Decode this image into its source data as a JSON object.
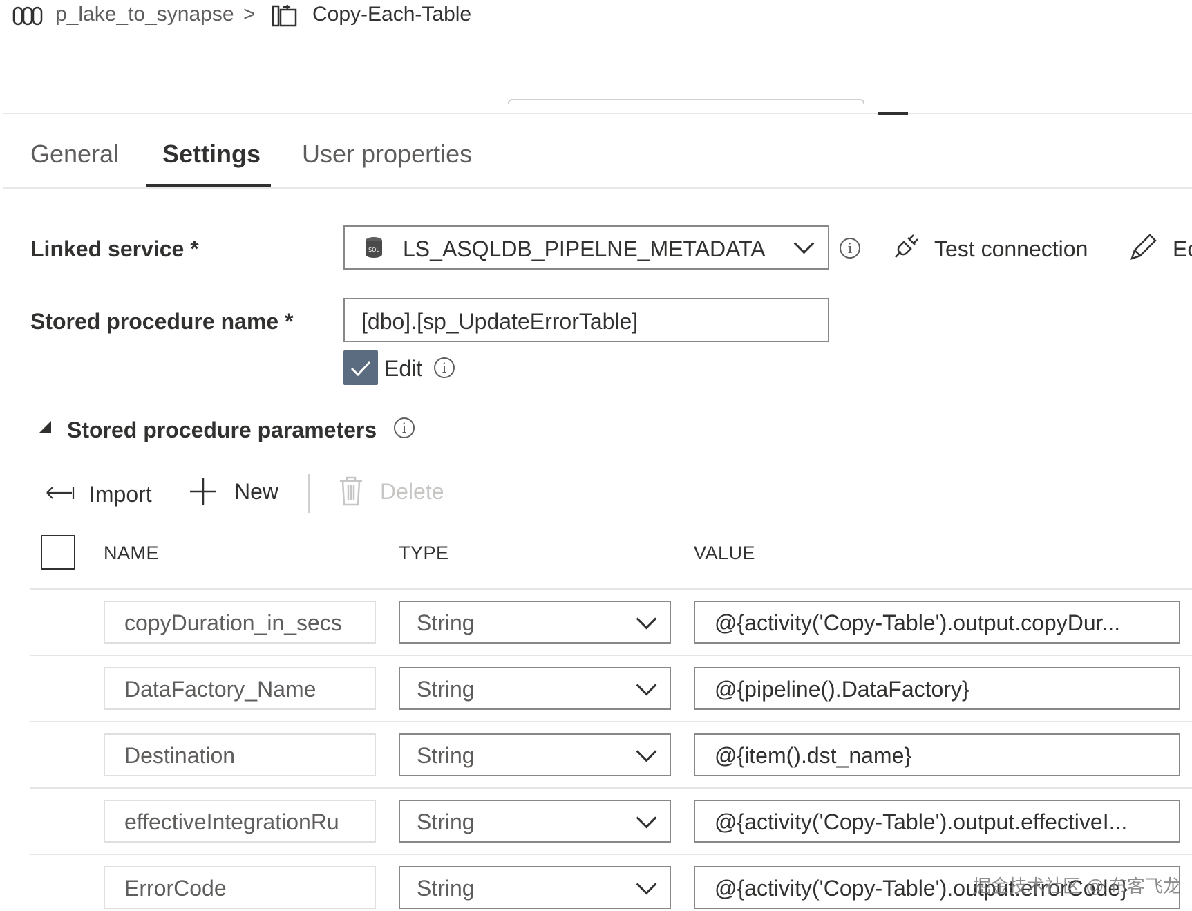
{
  "breadcrumb": {
    "pipeline": "p_lake_to_synapse",
    "separator": ">",
    "activity": "Copy-Each-Table"
  },
  "tabs": [
    {
      "label": "General",
      "active": false
    },
    {
      "label": "Settings",
      "active": true
    },
    {
      "label": "User properties",
      "active": false
    }
  ],
  "settings": {
    "linked_service_label": "Linked service *",
    "linked_service_value": "LS_ASQLDB_PIPELNE_METADATA",
    "test_connection_label": "Test connection",
    "edit_truncated_label": "Ec",
    "stored_proc_label": "Stored procedure name *",
    "stored_proc_value": "[dbo].[sp_UpdateErrorTable]",
    "edit_checkbox_label": "Edit",
    "edit_checked": true
  },
  "params_section": {
    "title": "Stored procedure parameters",
    "toolbar": {
      "import_label": "Import",
      "new_label": "New",
      "delete_label": "Delete"
    },
    "columns": [
      "NAME",
      "TYPE",
      "VALUE"
    ],
    "rows": [
      {
        "name": "copyDuration_in_secs",
        "type": "String",
        "value": "@{activity('Copy-Table').output.copyDur..."
      },
      {
        "name": "DataFactory_Name",
        "type": "String",
        "value": "@{pipeline().DataFactory}"
      },
      {
        "name": "Destination",
        "type": "String",
        "value": "@{item().dst_name}"
      },
      {
        "name": "effectiveIntegrationRu",
        "type": "String",
        "value": "@{activity('Copy-Table').output.effectiveI..."
      },
      {
        "name": "ErrorCode",
        "type": "String",
        "value": "@{activity('Copy-Table').output.errorCode}"
      }
    ]
  },
  "watermark": "掘金技术社区 @ 布客飞龙",
  "colors": {
    "checkbox_fill": "#5b6c80",
    "text_primary": "#323130",
    "text_secondary": "#605e5c",
    "disabled": "#c8c6c4"
  }
}
